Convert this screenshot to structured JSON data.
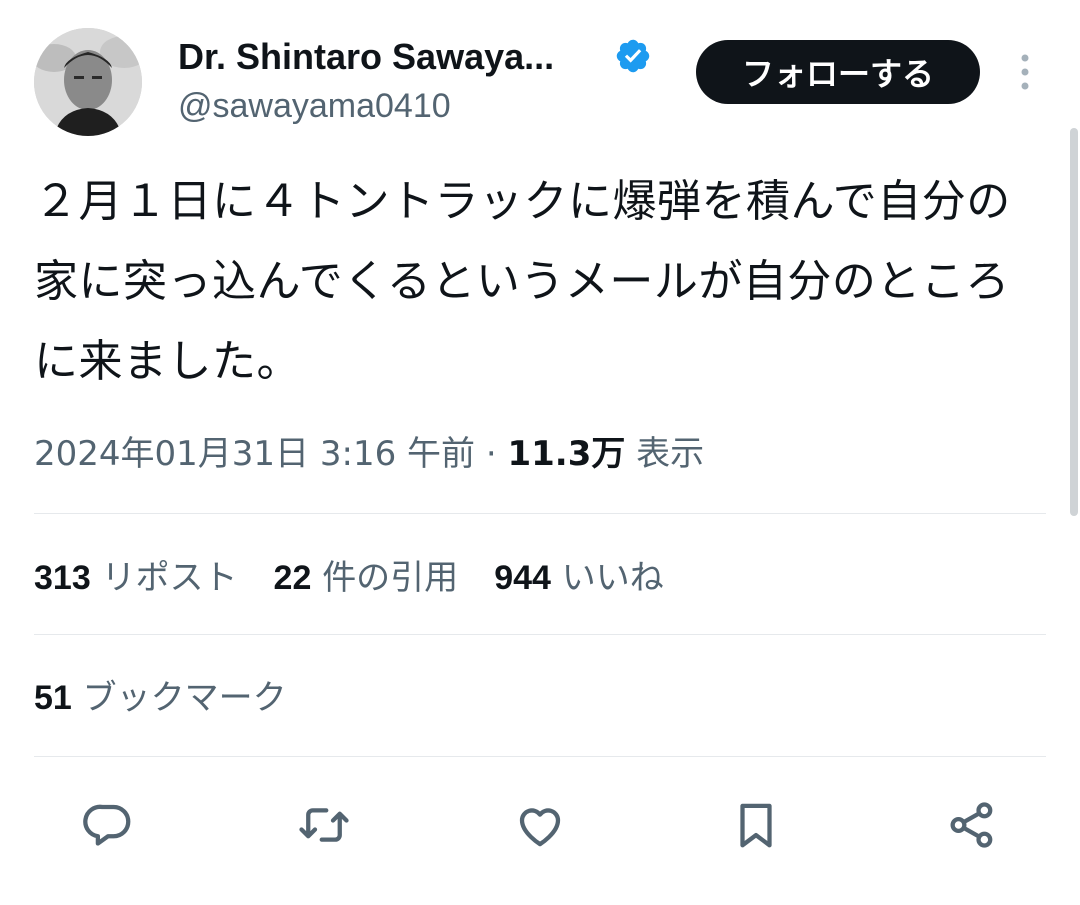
{
  "author": {
    "display_name": "Dr. Shintaro Sawaya...",
    "handle": "@sawayama0410",
    "verified": true,
    "avatar": "profile-photo"
  },
  "header": {
    "follow_label": "フォローする",
    "more_icon": "more-vertical-icon"
  },
  "tweet": {
    "text": "２月１日に４トントラックに爆弾を積んで自分の家に突っ込んでくるというメールが自分のところに来ました。",
    "timestamp": "2024年01月31日 3:16 午前",
    "separator": " · ",
    "views_count": "11.3万",
    "views_label": "表示"
  },
  "stats": {
    "reposts_count": "313",
    "reposts_label": "リポスト",
    "quotes_count": "22",
    "quotes_label": "件の引用",
    "likes_count": "944",
    "likes_label": "いいね",
    "bookmarks_count": "51",
    "bookmarks_label": "ブックマーク"
  },
  "actions": [
    "reply-icon",
    "repost-icon",
    "like-icon",
    "bookmark-icon",
    "share-icon"
  ],
  "colors": {
    "text_primary": "#0f1419",
    "text_secondary": "#536471",
    "verified_blue": "#1d9bf0",
    "follow_bg": "#0f1419",
    "divider": "#e6e9ec"
  }
}
